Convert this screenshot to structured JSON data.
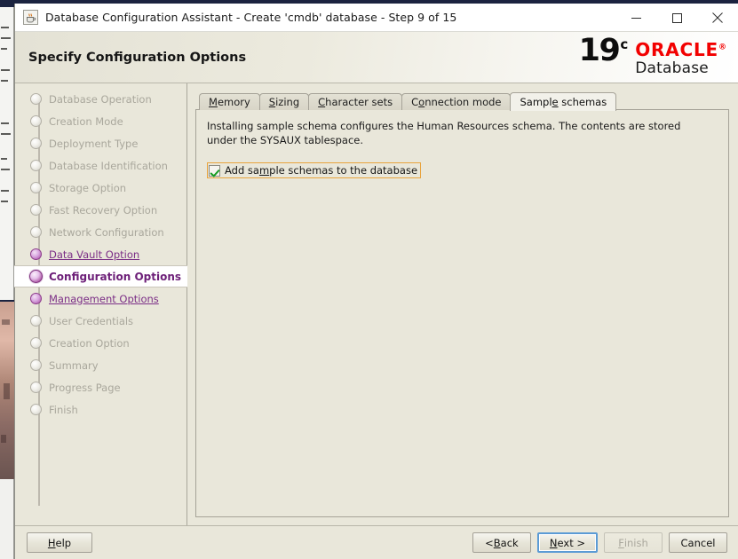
{
  "window": {
    "title": "Database Configuration Assistant - Create 'cmdb' database - Step 9 of 15",
    "app_icon": "java-coffee-cup-icon",
    "controls": {
      "minimize": "—",
      "maximize": "☐",
      "close": "✕"
    }
  },
  "header": {
    "heading": "Specify Configuration Options",
    "logo": {
      "version": "19",
      "superscript": "c",
      "brand": "ORACLE",
      "registered": "®",
      "product": "Database"
    }
  },
  "sidebar": {
    "items": [
      {
        "label": "Database Operation",
        "state": "pending"
      },
      {
        "label": "Creation Mode",
        "state": "pending"
      },
      {
        "label": "Deployment Type",
        "state": "pending"
      },
      {
        "label": "Database Identification",
        "state": "pending"
      },
      {
        "label": "Storage Option",
        "state": "pending"
      },
      {
        "label": "Fast Recovery Option",
        "state": "pending"
      },
      {
        "label": "Network Configuration",
        "state": "pending"
      },
      {
        "label": "Data Vault Option",
        "state": "done"
      },
      {
        "label": "Configuration Options",
        "state": "selected"
      },
      {
        "label": "Management Options",
        "state": "done"
      },
      {
        "label": "User Credentials",
        "state": "pending"
      },
      {
        "label": "Creation Option",
        "state": "pending"
      },
      {
        "label": "Summary",
        "state": "pending"
      },
      {
        "label": "Progress Page",
        "state": "pending"
      },
      {
        "label": "Finish",
        "state": "pending"
      }
    ]
  },
  "tabs": [
    {
      "label": "Memory",
      "mnemonic_index": 0,
      "active": false
    },
    {
      "label": "Sizing",
      "mnemonic_index": 0,
      "active": false
    },
    {
      "label": "Character sets",
      "mnemonic_index": 0,
      "active": false
    },
    {
      "label": "Connection mode",
      "mnemonic_index": 1,
      "active": false
    },
    {
      "label": "Sample schemas",
      "mnemonic_index": 5,
      "active": true
    }
  ],
  "panel": {
    "description": "Installing sample schema configures the Human Resources schema. The contents are stored under the SYSAUX tablespace.",
    "checkbox": {
      "label": "Add sample schemas to the database",
      "mnemonic_index": 6,
      "checked": true,
      "focused": true
    }
  },
  "footer": {
    "help": {
      "label": "Help",
      "mnemonic_index": 0,
      "enabled": true,
      "focused": false
    },
    "back": {
      "label": "< Back",
      "mnemonic_index": 2,
      "enabled": true,
      "focused": false
    },
    "next": {
      "label": "Next >",
      "mnemonic_index": 0,
      "enabled": true,
      "focused": true
    },
    "finish": {
      "label": "Finish",
      "mnemonic_index": 0,
      "enabled": false,
      "focused": false
    },
    "cancel": {
      "label": "Cancel",
      "mnemonic_index": -1,
      "enabled": true,
      "focused": false
    }
  },
  "colors": {
    "window_bg": "#e9e7da",
    "panel_bg": "#e9e7da",
    "accent_purple": "#6d1f78",
    "oracle_red": "#f20000",
    "focus_orange": "#e8a33d",
    "focus_blue": "#5b9bd5",
    "check_green": "#169b22",
    "disabled_text": "#a9a79c"
  }
}
